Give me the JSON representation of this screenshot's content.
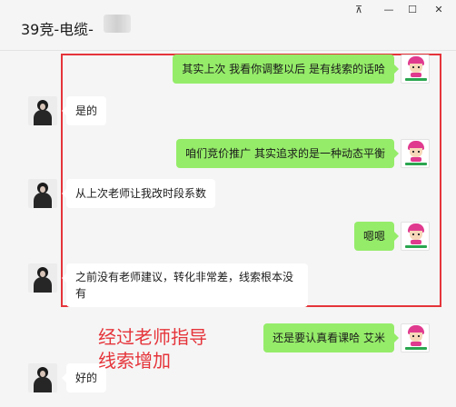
{
  "window": {
    "title": "39竞-电缆-",
    "controls": {
      "pin": "⊼",
      "minimize": "—",
      "maximize": "☐",
      "close": "✕"
    }
  },
  "messages": [
    {
      "from": "me",
      "text": "其实上次 我看你调整以后 是有线索的话哈"
    },
    {
      "from": "teacher",
      "text": "是的"
    },
    {
      "from": "me",
      "text": "咱们竞价推广  其实追求的是一种动态平衡"
    },
    {
      "from": "teacher",
      "text": "从上次老师让我改时段系数"
    },
    {
      "from": "me",
      "text": "嗯嗯"
    },
    {
      "from": "teacher",
      "text": "之前没有老师建议，转化非常差，线索根本没有"
    },
    {
      "from": "me",
      "text": "还是要认真看课哈  艾米"
    },
    {
      "from": "teacher",
      "text": "好的"
    }
  ],
  "annotation": {
    "line1": "经过老师指导",
    "line2": "线索增加",
    "color": "#e5343a"
  },
  "colors": {
    "bubble_me": "#95ec69",
    "bubble_other": "#ffffff",
    "highlight_border": "#e5343a"
  }
}
